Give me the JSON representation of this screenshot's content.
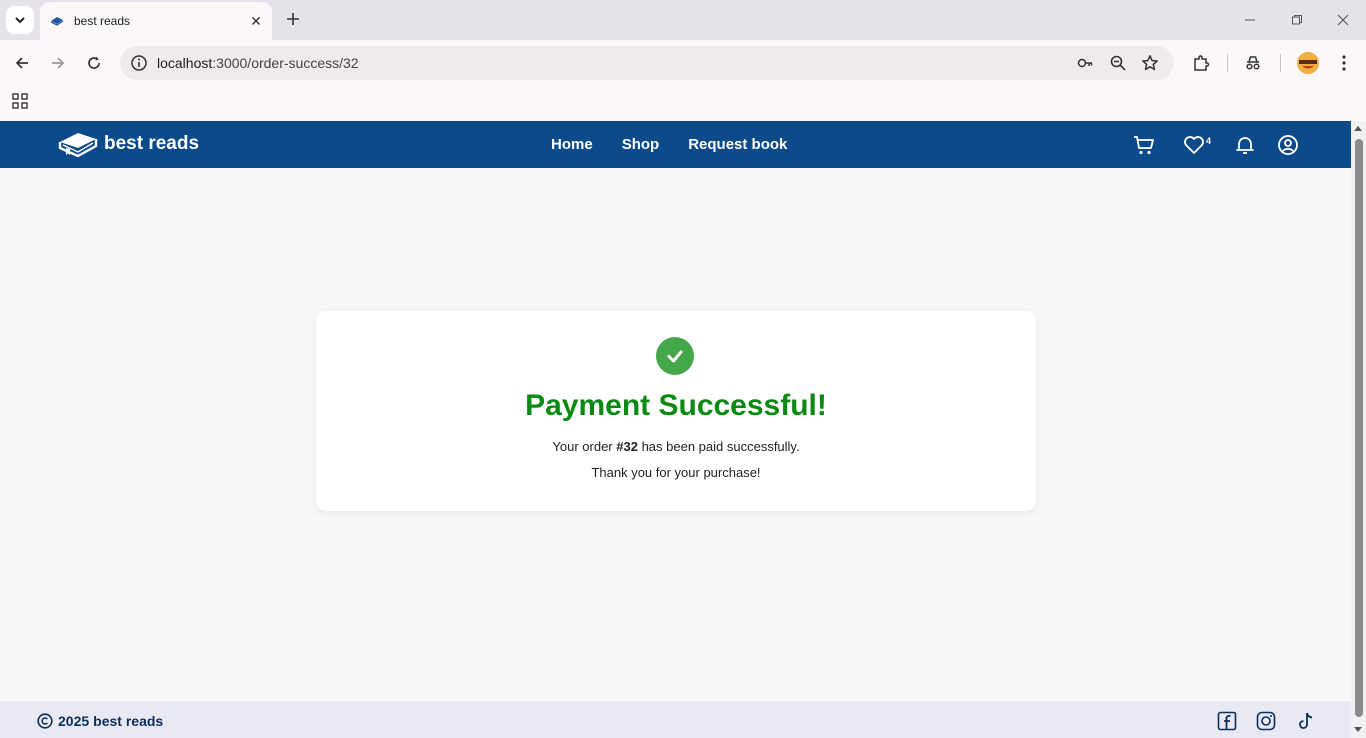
{
  "browser": {
    "tab_title": "best reads",
    "url_host": "localhost",
    "url_path": ":3000/order-success/32"
  },
  "site": {
    "brand": "best reads",
    "nav": [
      "Home",
      "Shop",
      "Request book"
    ],
    "wishlist_count": "4",
    "colors": {
      "navbar": "#0c4a89",
      "success": "#0a8a12",
      "check_bg": "#44a84a"
    }
  },
  "card": {
    "title": "Payment Successful!",
    "msg_prefix": "Your order ",
    "order_id": "#32",
    "msg_suffix": " has been paid successfully.",
    "thanks": "Thank you for your purchase!"
  },
  "footer": {
    "year": "2025",
    "name": "best reads"
  },
  "icons": [
    "tab-list-icon",
    "favicon-icon",
    "close-icon",
    "plus-icon",
    "minimize-icon",
    "restore-icon",
    "back-icon",
    "forward-icon",
    "reload-icon",
    "site-info-icon",
    "key-icon",
    "zoom-icon",
    "star-icon",
    "extensions-icon",
    "incognito-icon",
    "menu-icon",
    "apps-icon",
    "book-logo-icon",
    "cart-icon",
    "heart-icon",
    "bell-icon",
    "user-icon",
    "check-icon",
    "copyright-icon",
    "facebook-icon",
    "instagram-icon",
    "tiktok-icon"
  ]
}
